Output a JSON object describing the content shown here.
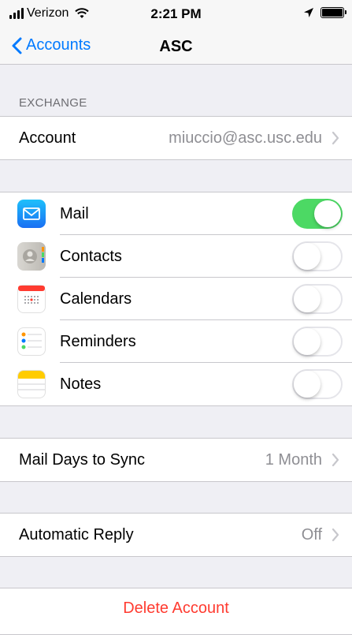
{
  "status_bar": {
    "carrier": "Verizon",
    "time": "2:21 PM",
    "icons": [
      "signal-icon",
      "wifi-icon",
      "location-arrow-icon",
      "battery-icon"
    ]
  },
  "nav": {
    "back_label": "Accounts",
    "title": "ASC"
  },
  "exchange": {
    "header": "EXCHANGE",
    "account_label": "Account",
    "account_value": "miuccio@asc.usc.edu"
  },
  "services": [
    {
      "label": "Mail",
      "icon": "mail-icon",
      "on": true
    },
    {
      "label": "Contacts",
      "icon": "contacts-icon",
      "on": false
    },
    {
      "label": "Calendars",
      "icon": "calendar-icon",
      "on": false
    },
    {
      "label": "Reminders",
      "icon": "reminders-icon",
      "on": false
    },
    {
      "label": "Notes",
      "icon": "notes-icon",
      "on": false
    }
  ],
  "mail_days": {
    "label": "Mail Days to Sync",
    "value": "1 Month"
  },
  "auto_reply": {
    "label": "Automatic Reply",
    "value": "Off"
  },
  "delete_label": "Delete Account",
  "colors": {
    "accent": "#007aff",
    "toggle_on": "#4cd964",
    "destructive": "#ff3b30",
    "background": "#efeff4"
  }
}
